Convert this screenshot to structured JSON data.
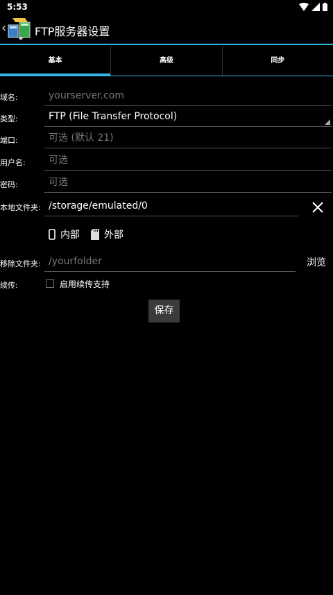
{
  "status": {
    "time": "5:53"
  },
  "app": {
    "title": "FTP服务器设置"
  },
  "tabs": [
    {
      "label": "基本"
    },
    {
      "label": "高级"
    },
    {
      "label": "同步"
    }
  ],
  "form": {
    "domain": {
      "label": "域名:",
      "placeholder": "yourserver.com"
    },
    "type": {
      "label": "类型:",
      "value": "FTP (File Transfer Protocol)"
    },
    "port": {
      "label": "端口:",
      "placeholder": "可选 (默认 21)"
    },
    "username": {
      "label": "用户名:",
      "placeholder": "可选"
    },
    "password": {
      "label": "密码:",
      "placeholder": "可选"
    },
    "local_folder": {
      "label": "本地文件夹:",
      "value": "/storage/emulated/0"
    },
    "storage": {
      "internal": "内部",
      "external": "外部"
    },
    "remote_folder": {
      "label": "移除文件夹:",
      "placeholder": "/yourfolder",
      "browse": "浏览"
    },
    "resume": {
      "label": "续传:",
      "checkbox_label": "启用续传支持"
    },
    "save": "保存"
  },
  "colors": {
    "accent": "#33b5e5",
    "background": "#000000"
  }
}
